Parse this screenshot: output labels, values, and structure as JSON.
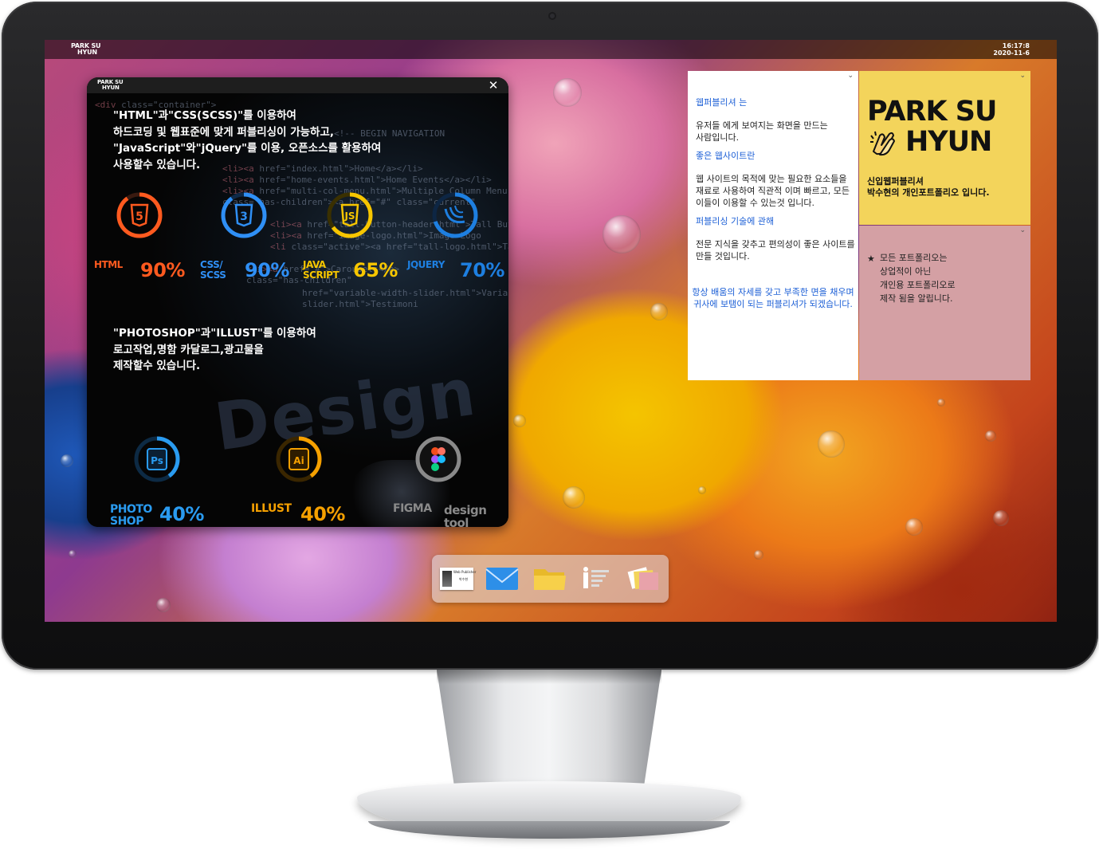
{
  "topbar": {
    "logo_line1": "PARK SU",
    "logo_line2": "HYUN",
    "clock_time": "16:17:8",
    "clock_date": "2020-11-6"
  },
  "skills_window": {
    "logo_line1": "PARK SU",
    "logo_line2": "HYUN",
    "close_icon": "close-icon",
    "dev_description": [
      "\"HTML\"과\"CSS(SCSS)\"를 이용하여",
      "하드코딩 및 웹표준에 맞게 퍼블리싱이 가능하고,",
      "\"JavaScript\"와\"jQuery\"를 이용, 오픈소스를 활용하여",
      "사용할수 있습니다."
    ],
    "dev_skills": [
      {
        "name": "HTML",
        "name2": "",
        "percent": "90%",
        "value": 0.9,
        "icon": "html5-icon",
        "color": "#ff5a1f"
      },
      {
        "name": "CSS/",
        "name2": "SCSS",
        "percent": "90%",
        "value": 0.9,
        "icon": "css3-icon",
        "color": "#2f8ff5"
      },
      {
        "name": "JAVA",
        "name2": "SCRIPT",
        "percent": "65%",
        "value": 0.65,
        "icon": "javascript-icon",
        "color": "#f7c600"
      },
      {
        "name": "JQUERY",
        "name2": "",
        "percent": "70%",
        "value": 0.7,
        "icon": "jquery-icon",
        "color": "#1e7fe0"
      }
    ],
    "design_description": [
      "\"PHOTOSHOP\"과\"ILLUST\"를 이용하여",
      "로고작업,명함 카달로그,광고물을",
      "제작할수 있습니다."
    ],
    "design_skills": [
      {
        "name": "PHOTO",
        "name2": "SHOP",
        "percent": "40%",
        "value": 0.4,
        "icon": "photoshop-icon",
        "color": "#2a9bf0"
      },
      {
        "name": "ILLUST",
        "name2": "",
        "percent": "40%",
        "value": 0.4,
        "icon": "illustrator-icon",
        "color": "#f5a000"
      },
      {
        "name": "FIGMA",
        "name2": "",
        "percent": "design",
        "percent2": "tool",
        "value": 1.0,
        "icon": "figma-icon",
        "color": "#8a8a8a"
      }
    ]
  },
  "note_white": {
    "heading1": "웹퍼블리셔 는",
    "text1": [
      "유저들 에게 보여지는 화면을 만드는",
      "사람입니다."
    ],
    "heading2": "좋은 웹사이트란",
    "text2": [
      "웹 사이트의 목적에 맞는 필요한 요소들을",
      "재료로 사용하여 직관적 이며 빠르고, 모든",
      "이들이 이용할 수 있는것 입니다."
    ],
    "heading3": "퍼블리싱 기술에 관해",
    "text3": [
      "전문 지식을 갖추고 편의성이 좋은 사이트를",
      "만들 것입니다."
    ],
    "closing": [
      "항상 배움의 자세를 갖고 부족한 면을 채우며",
      "귀사에 보탬이 되는 퍼블리셔가 되겠습니다."
    ]
  },
  "note_yellow": {
    "logo_line1": "PARK SU",
    "logo_line2": "HYUN",
    "hands_icon": "clapping-hands-icon",
    "subtitle1": "신입웹퍼블리셔",
    "subtitle2": "박수현의 개인포트폴리오 입니다."
  },
  "note_pink": {
    "bullet": "★",
    "lines": [
      "모든 포트폴리오는",
      "상업적이 아닌",
      "개인용 포트폴리오로",
      "제작 됨을 알립니다."
    ]
  },
  "dock": {
    "items": [
      {
        "icon": "business-card-icon",
        "card_title": "Web Publisher",
        "card_name": "박수현"
      },
      {
        "icon": "mail-icon"
      },
      {
        "icon": "folder-icon"
      },
      {
        "icon": "profile-info-icon"
      },
      {
        "icon": "sticky-notes-icon"
      }
    ]
  },
  "colors": {
    "note_yellow": "#f3d45b",
    "note_pink": "#d4a0a4",
    "link_blue": "#1c5fd6"
  }
}
